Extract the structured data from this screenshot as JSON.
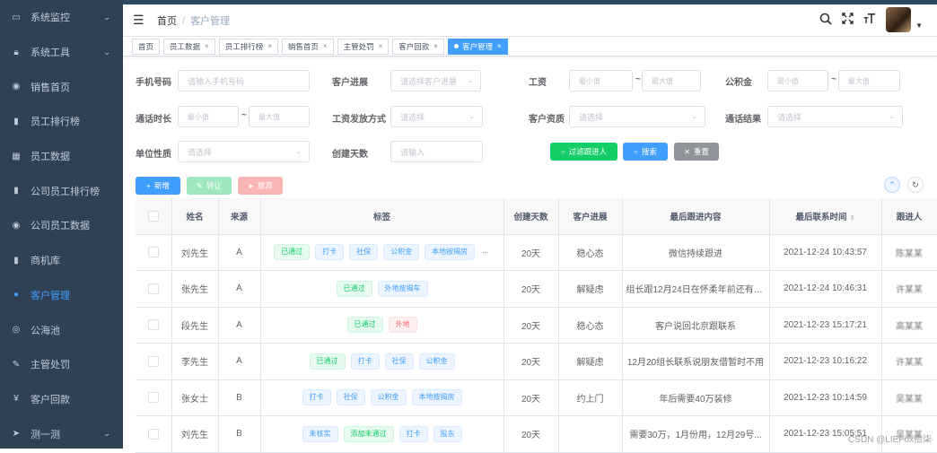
{
  "sidebar": {
    "items": [
      {
        "label": "系统监控",
        "icon": "monitor-icon",
        "chevron": true
      },
      {
        "label": "系统工具",
        "icon": "lock-icon",
        "chevron": true
      },
      {
        "label": "销售首页",
        "icon": "dashboard-icon",
        "chevron": false
      },
      {
        "label": "员工排行榜",
        "icon": "bar-chart-icon",
        "chevron": false
      },
      {
        "label": "员工数据",
        "icon": "table-icon",
        "chevron": false
      },
      {
        "label": "公司员工排行榜",
        "icon": "bar-chart-icon",
        "chevron": false
      },
      {
        "label": "公司员工数据",
        "icon": "dashboard-icon",
        "chevron": false
      },
      {
        "label": "商机库",
        "icon": "bar-chart-icon",
        "chevron": false
      },
      {
        "label": "客户管理",
        "icon": "user-icon",
        "chevron": false,
        "active": true
      },
      {
        "label": "公海池",
        "icon": "globe-icon",
        "chevron": false
      },
      {
        "label": "主管处罚",
        "icon": "edit-icon",
        "chevron": false
      },
      {
        "label": "客户回款",
        "icon": "yen-icon",
        "chevron": false
      },
      {
        "label": "测一测",
        "icon": "send-icon",
        "chevron": true
      }
    ]
  },
  "breadcrumb": {
    "home": "首页",
    "current": "客户管理"
  },
  "tags": [
    {
      "label": "首页",
      "closable": false
    },
    {
      "label": "员工数据",
      "closable": true
    },
    {
      "label": "员工排行榜",
      "closable": true
    },
    {
      "label": "销售首页",
      "closable": true
    },
    {
      "label": "主管处罚",
      "closable": true
    },
    {
      "label": "客户回款",
      "closable": true
    },
    {
      "label": "客户管理",
      "closable": true,
      "active": true
    }
  ],
  "filters": {
    "phone": {
      "label": "手机号码",
      "placeholder": "请输入手机号码"
    },
    "progress": {
      "label": "客户进展",
      "placeholder": "请选择客户进展"
    },
    "salary": {
      "label": "工资",
      "min": "最小值",
      "max": "最大值"
    },
    "fund": {
      "label": "公积金",
      "min": "最小值",
      "max": "最大值"
    },
    "duration": {
      "label": "通话时长",
      "min": "最小值",
      "max": "最大值"
    },
    "pay_method": {
      "label": "工资发放方式",
      "placeholder": "请选择"
    },
    "qualification": {
      "label": "客户资质",
      "placeholder": "请选择"
    },
    "call_result": {
      "label": "通话结果",
      "placeholder": "请选择"
    },
    "unit_type": {
      "label": "单位性质",
      "placeholder": "请选择"
    },
    "created_days": {
      "label": "创建天数",
      "placeholder": "请输入"
    },
    "tilde": "~"
  },
  "buttons": {
    "filter_follow": "过滤跟进人",
    "search": "搜索",
    "reset": "重置",
    "add": "新增",
    "transfer": "转让",
    "abandon": "放弃"
  },
  "table": {
    "headers": [
      "",
      "姓名",
      "来源",
      "标签",
      "创建天数",
      "客户进展",
      "最后跟进内容",
      "最后联系时间",
      "跟进人"
    ],
    "rows": [
      {
        "name": "刘先生",
        "source": "A",
        "tags": [
          {
            "t": "已通过",
            "c": "green"
          },
          {
            "t": "打卡",
            "c": "blue"
          },
          {
            "t": "社保",
            "c": "blue"
          },
          {
            "t": "公积金",
            "c": "blue"
          },
          {
            "t": "本地按揭房",
            "c": "blue"
          },
          {
            "t": "...",
            "c": "ell"
          }
        ],
        "days": "20天",
        "progress": "稳心态",
        "content": "微信持续跟进",
        "time": "2021-12-24 10:43:57",
        "follower": "陈某某"
      },
      {
        "name": "张先生",
        "source": "A",
        "tags": [
          {
            "t": "已通过",
            "c": "green"
          },
          {
            "t": "外地按揭车",
            "c": "blue"
          }
        ],
        "days": "20天",
        "progress": "解疑虑",
        "content": "组长跟12月24日在怀柔年前还有资...",
        "time": "2021-12-24 10:46:31",
        "follower": "许某某"
      },
      {
        "name": "段先生",
        "source": "A",
        "tags": [
          {
            "t": "已通过",
            "c": "green"
          },
          {
            "t": "外地",
            "c": "red"
          }
        ],
        "days": "20天",
        "progress": "稳心态",
        "content": "客户说回北京跟联系",
        "time": "2021-12-23 15:17:21",
        "follower": "高某某"
      },
      {
        "name": "李先生",
        "source": "A",
        "tags": [
          {
            "t": "已通过",
            "c": "green"
          },
          {
            "t": "打卡",
            "c": "blue"
          },
          {
            "t": "社保",
            "c": "blue"
          },
          {
            "t": "公积金",
            "c": "blue"
          }
        ],
        "days": "20天",
        "progress": "解疑虑",
        "content": "12月20组长联系说朋友借暂时不用",
        "time": "2021-12-23 10:16:22",
        "follower": "许某某"
      },
      {
        "name": "张女士",
        "source": "B",
        "tags": [
          {
            "t": "打卡",
            "c": "blue"
          },
          {
            "t": "社保",
            "c": "blue"
          },
          {
            "t": "公积金",
            "c": "blue"
          },
          {
            "t": "本地按揭房",
            "c": "blue"
          }
        ],
        "days": "20天",
        "progress": "约上门",
        "content": "年后需要40万装修",
        "time": "2021-12-23 10:14:59",
        "follower": "吴某某"
      },
      {
        "name": "刘先生",
        "source": "B",
        "tags": [
          {
            "t": "未核实",
            "c": "blue"
          },
          {
            "t": "添加未通过",
            "c": "green"
          },
          {
            "t": "打卡",
            "c": "blue"
          },
          {
            "t": "股东",
            "c": "blue"
          }
        ],
        "days": "20天",
        "progress": "",
        "content": "需要30万，1月份用，12月29号...",
        "time": "2021-12-23 15:05:51",
        "follower": "吴某某"
      }
    ]
  },
  "watermark": "CSDN @LIEFox拾柒",
  "colors": {
    "sidebar_bg": "#304156",
    "primary": "#409eff",
    "success": "#13ce66",
    "danger": "#f56c6c",
    "info": "#909399"
  }
}
